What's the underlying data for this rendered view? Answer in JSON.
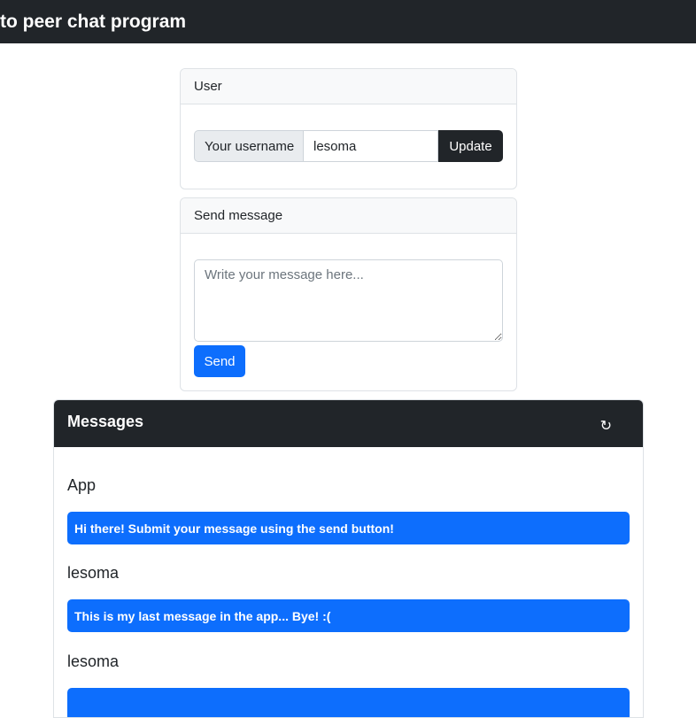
{
  "navbar": {
    "title": "to peer chat program"
  },
  "user_card": {
    "header": "User",
    "username_label": "Your username",
    "username_value": "lesoma",
    "update_label": "Update"
  },
  "send_card": {
    "header": "Send message",
    "placeholder": "Write your message here...",
    "send_label": "Send"
  },
  "messages_card": {
    "title": "Messages",
    "refresh_icon": "↻",
    "items": [
      {
        "author": "App",
        "text": "Hi there! Submit your message using the send button!"
      },
      {
        "author": "lesoma",
        "text": "This is my last message in the app... Bye! :("
      },
      {
        "author": "lesoma",
        "text": ""
      }
    ]
  },
  "colors": {
    "navbar_bg": "#212529",
    "primary": "#0d6efd",
    "card_border": "#dee2e6"
  }
}
